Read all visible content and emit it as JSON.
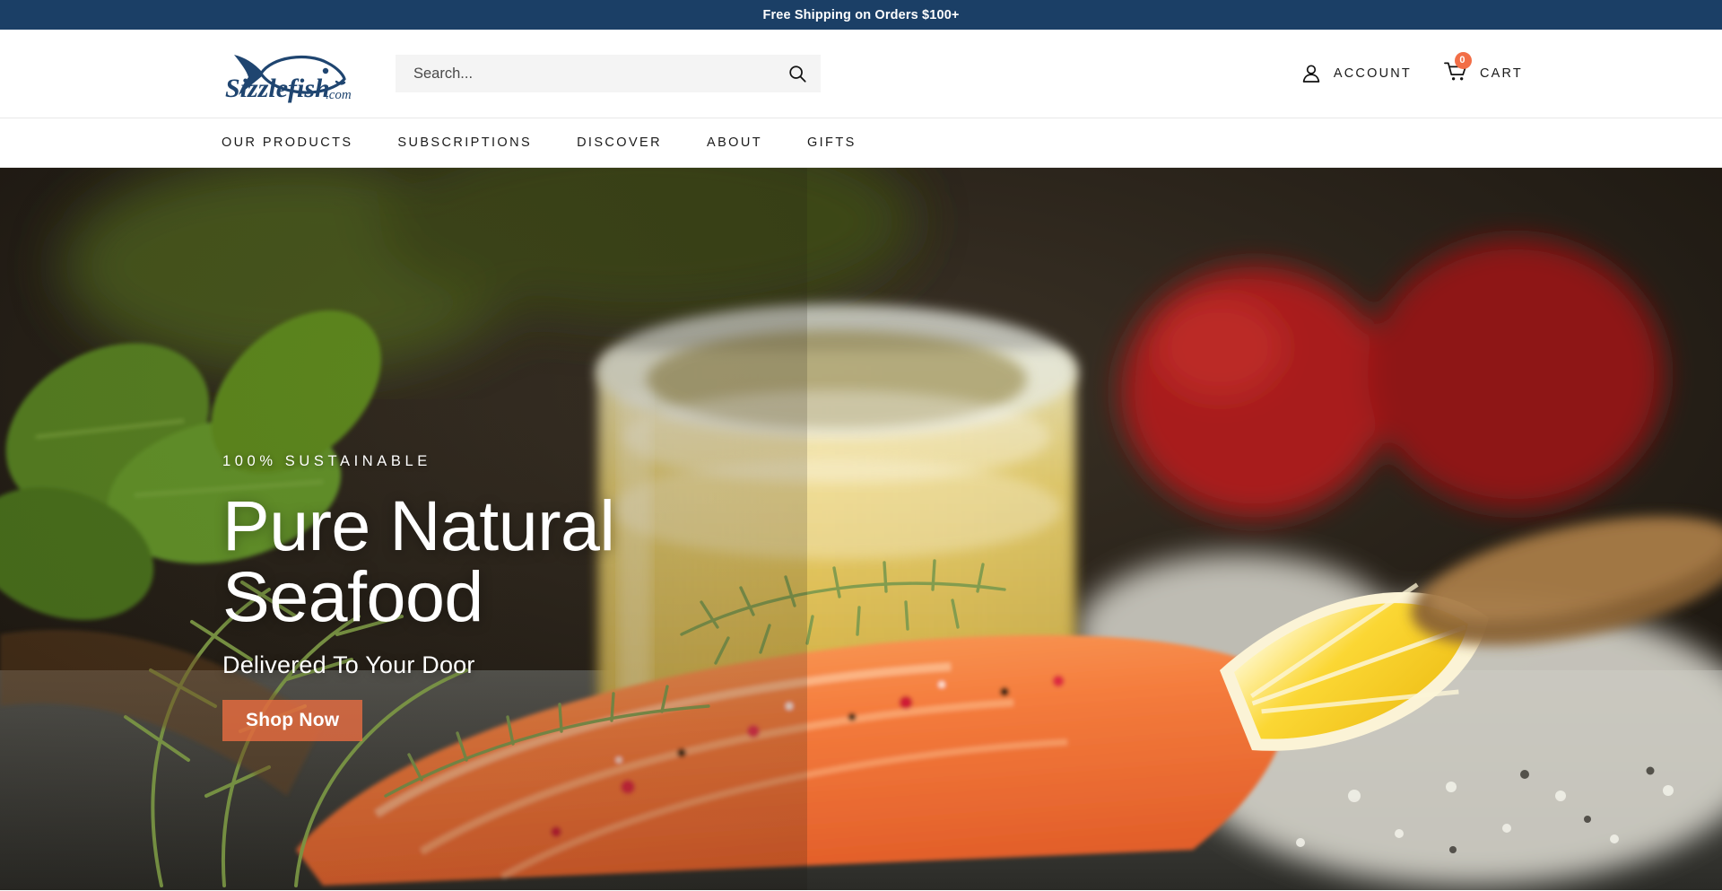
{
  "announcement": {
    "text": "Free Shipping on Orders $100+",
    "background": "#1B3F66",
    "color": "#FFFFFF"
  },
  "header": {
    "logo_alt": "Sizzlefish.com",
    "logo_wordmark": "Sizzlefish",
    "logo_suffix": ".com",
    "logo_color": "#1F4570",
    "search": {
      "placeholder": "Search...",
      "value": "",
      "icon": "search-icon"
    },
    "account": {
      "label": "ACCOUNT",
      "icon": "user-icon"
    },
    "cart": {
      "label": "CART",
      "icon": "cart-icon",
      "count": "0",
      "badge_color": "#F26E47"
    }
  },
  "nav": {
    "items": [
      {
        "label": "OUR PRODUCTS"
      },
      {
        "label": "SUBSCRIPTIONS"
      },
      {
        "label": "DISCOVER"
      },
      {
        "label": "ABOUT"
      },
      {
        "label": "GIFTS"
      }
    ]
  },
  "hero": {
    "eyebrow": "100% SUSTAINABLE",
    "title_line1": "Pure Natural",
    "title_line2": "Seafood",
    "subtitle": "Delivered To Your Door",
    "cta_label": "Shop Now",
    "cta_color": "#ED6E41",
    "image_description": "Raw salmon fillet with dill, pink peppercorns and sea salt, a glass jar of olive oil, basil leaves, tomatoes and a lemon wedge on a dark slate surface"
  }
}
